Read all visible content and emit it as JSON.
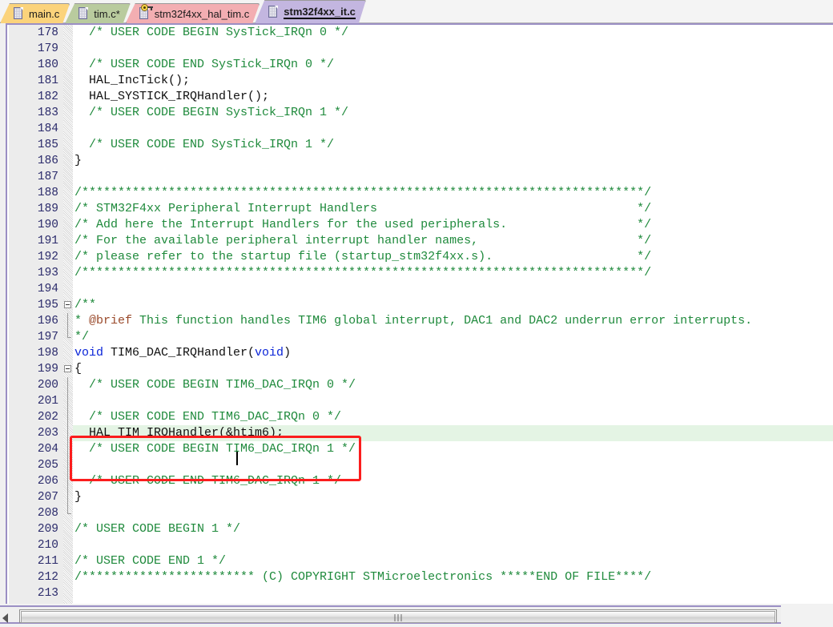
{
  "window": {
    "accent_purple": "#9b8fc4",
    "comment_green": "#1f8a3c",
    "keyword_blue": "#0a24d8",
    "doctag_brown": "#9a4a2b",
    "highlight_line_bg": "#e4f4e4",
    "annotation_red": "#fb1d1d"
  },
  "tabs": [
    {
      "label": "main.c",
      "color": "#fbd37b",
      "icon": "document-icon",
      "locked": false,
      "active": false,
      "modified": false
    },
    {
      "label": "tim.c*",
      "color": "#b9cb9e",
      "icon": "document-icon",
      "locked": false,
      "active": false,
      "modified": true
    },
    {
      "label": "stm32f4xx_hal_tim.c",
      "color": "#f3aeb2",
      "icon": "document-locked-icon",
      "locked": true,
      "active": false,
      "modified": false
    },
    {
      "label": "stm32f4xx_it.c",
      "color": "#c3b6e0",
      "icon": "document-icon",
      "locked": false,
      "active": true,
      "modified": false
    }
  ],
  "editor": {
    "first_line": 178,
    "last_line": 213,
    "current_line": 203,
    "caret_column_text": "HAL_TIM_IRQHandler(&htim6);",
    "lines": [
      {
        "n": 178,
        "fold": "",
        "tokens": [
          {
            "t": "cmt",
            "s": "  /* USER CODE BEGIN SysTick_IRQn 0 */"
          }
        ]
      },
      {
        "n": 179,
        "fold": "",
        "tokens": [
          {
            "t": "pln",
            "s": ""
          }
        ]
      },
      {
        "n": 180,
        "fold": "",
        "tokens": [
          {
            "t": "cmt",
            "s": "  /* USER CODE END SysTick_IRQn 0 */"
          }
        ]
      },
      {
        "n": 181,
        "fold": "",
        "tokens": [
          {
            "t": "pln",
            "s": "  HAL_IncTick();"
          }
        ]
      },
      {
        "n": 182,
        "fold": "",
        "tokens": [
          {
            "t": "pln",
            "s": "  HAL_SYSTICK_IRQHandler();"
          }
        ]
      },
      {
        "n": 183,
        "fold": "",
        "tokens": [
          {
            "t": "cmt",
            "s": "  /* USER CODE BEGIN SysTick_IRQn 1 */"
          }
        ]
      },
      {
        "n": 184,
        "fold": "",
        "tokens": [
          {
            "t": "pln",
            "s": ""
          }
        ]
      },
      {
        "n": 185,
        "fold": "",
        "tokens": [
          {
            "t": "cmt",
            "s": "  /* USER CODE END SysTick_IRQn 1 */"
          }
        ]
      },
      {
        "n": 186,
        "fold": "",
        "tokens": [
          {
            "t": "pln",
            "s": "}"
          }
        ]
      },
      {
        "n": 187,
        "fold": "",
        "tokens": [
          {
            "t": "pln",
            "s": ""
          }
        ]
      },
      {
        "n": 188,
        "fold": "",
        "tokens": [
          {
            "t": "cmt",
            "s": "/******************************************************************************/"
          }
        ]
      },
      {
        "n": 189,
        "fold": "",
        "tokens": [
          {
            "t": "cmt",
            "s": "/* STM32F4xx Peripheral Interrupt Handlers                                    */"
          }
        ]
      },
      {
        "n": 190,
        "fold": "",
        "tokens": [
          {
            "t": "cmt",
            "s": "/* Add here the Interrupt Handlers for the used peripherals.                  */"
          }
        ]
      },
      {
        "n": 191,
        "fold": "",
        "tokens": [
          {
            "t": "cmt",
            "s": "/* For the available peripheral interrupt handler names,                      */"
          }
        ]
      },
      {
        "n": 192,
        "fold": "",
        "tokens": [
          {
            "t": "cmt",
            "s": "/* please refer to the startup file (startup_stm32f4xx.s).                    */"
          }
        ]
      },
      {
        "n": 193,
        "fold": "",
        "tokens": [
          {
            "t": "cmt",
            "s": "/******************************************************************************/"
          }
        ]
      },
      {
        "n": 194,
        "fold": "",
        "tokens": [
          {
            "t": "pln",
            "s": ""
          }
        ]
      },
      {
        "n": 195,
        "fold": "box",
        "tokens": [
          {
            "t": "cmt",
            "s": "/**"
          }
        ]
      },
      {
        "n": 196,
        "fold": "line",
        "tokens": [
          {
            "t": "cmt",
            "s": "* "
          },
          {
            "t": "tag",
            "s": "@brief"
          },
          {
            "t": "cmt",
            "s": " This function handles TIM6 global interrupt, DAC1 and DAC2 underrun error interrupts."
          }
        ]
      },
      {
        "n": 197,
        "fold": "end",
        "tokens": [
          {
            "t": "cmt",
            "s": "*/"
          }
        ]
      },
      {
        "n": 198,
        "fold": "",
        "tokens": [
          {
            "t": "kw",
            "s": "void"
          },
          {
            "t": "pln",
            "s": " TIM6_DAC_IRQHandler("
          },
          {
            "t": "kw",
            "s": "void"
          },
          {
            "t": "pln",
            "s": ")"
          }
        ]
      },
      {
        "n": 199,
        "fold": "box",
        "tokens": [
          {
            "t": "pln",
            "s": "{"
          }
        ]
      },
      {
        "n": 200,
        "fold": "line",
        "tokens": [
          {
            "t": "cmt",
            "s": "  /* USER CODE BEGIN TIM6_DAC_IRQn 0 */"
          }
        ]
      },
      {
        "n": 201,
        "fold": "line",
        "tokens": [
          {
            "t": "pln",
            "s": ""
          }
        ]
      },
      {
        "n": 202,
        "fold": "line",
        "tokens": [
          {
            "t": "cmt",
            "s": "  /* USER CODE END TIM6_DAC_IRQn 0 */"
          }
        ]
      },
      {
        "n": 203,
        "fold": "line",
        "tokens": [
          {
            "t": "pln",
            "s": "  HAL_TIM_IRQHandler(&htim6);"
          }
        ]
      },
      {
        "n": 204,
        "fold": "line",
        "tokens": [
          {
            "t": "cmt",
            "s": "  /* USER CODE BEGIN TIM6_DAC_IRQn 1 */"
          }
        ]
      },
      {
        "n": 205,
        "fold": "line",
        "tokens": [
          {
            "t": "pln",
            "s": ""
          }
        ]
      },
      {
        "n": 206,
        "fold": "line",
        "tokens": [
          {
            "t": "cmt",
            "s": "  /* USER CODE END TIM6_DAC_IRQn 1 */"
          }
        ]
      },
      {
        "n": 207,
        "fold": "line",
        "tokens": [
          {
            "t": "pln",
            "s": "}"
          }
        ]
      },
      {
        "n": 208,
        "fold": "end",
        "tokens": [
          {
            "t": "pln",
            "s": ""
          }
        ]
      },
      {
        "n": 209,
        "fold": "",
        "tokens": [
          {
            "t": "cmt",
            "s": "/* USER CODE BEGIN 1 */"
          }
        ]
      },
      {
        "n": 210,
        "fold": "",
        "tokens": [
          {
            "t": "pln",
            "s": ""
          }
        ]
      },
      {
        "n": 211,
        "fold": "",
        "tokens": [
          {
            "t": "cmt",
            "s": "/* USER CODE END 1 */"
          }
        ]
      },
      {
        "n": 212,
        "fold": "",
        "tokens": [
          {
            "t": "cmt",
            "s": "/************************ (C) COPYRIGHT STMicroelectronics *****END OF FILE****/"
          }
        ]
      },
      {
        "n": 213,
        "fold": "",
        "tokens": [
          {
            "t": "pln",
            "s": ""
          }
        ]
      }
    ]
  },
  "scrollbar": {
    "orientation": "horizontal",
    "left_arrow_icon": "caret-left-icon",
    "grip_icon": "grip-lines-icon"
  }
}
